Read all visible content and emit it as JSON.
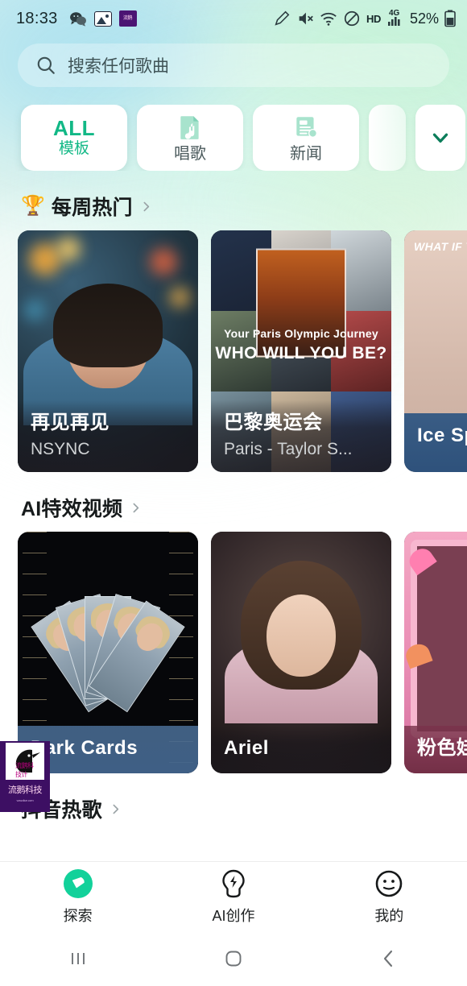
{
  "statusbar": {
    "time": "18:33",
    "icons_left": [
      "wechat-icon",
      "gallery-icon",
      "purple-app-icon"
    ],
    "pen_icon": "pen-icon",
    "mute_icon": "mute-icon",
    "wifi_icon": "wifi-icon",
    "dnd_icon": "do-not-disturb-icon",
    "hd_label": "HD",
    "network_label": "4G",
    "signal_icon": "signal-bars-icon",
    "battery_text": "52%",
    "battery_icon": "battery-icon"
  },
  "search": {
    "placeholder": "搜索任何歌曲",
    "icon": "search-icon"
  },
  "tabs": [
    {
      "id": "all",
      "main": "ALL",
      "sub": "模板",
      "icon": null,
      "selected": true
    },
    {
      "id": "sing",
      "main": "",
      "sub": "唱歌",
      "icon": "music-note-icon",
      "selected": false
    },
    {
      "id": "news",
      "main": "",
      "sub": "新闻",
      "icon": "document-icon",
      "selected": false
    },
    {
      "id": "partial",
      "main": "",
      "sub": "",
      "icon": null,
      "selected": false
    }
  ],
  "expand_button": {
    "icon": "chevron-down-icon",
    "accent": "#0b7d5a"
  },
  "sections": [
    {
      "id": "weekly-hot",
      "emoji": "🏆",
      "title": "每周热门",
      "chevron": "chevron-right-icon",
      "cards": [
        {
          "title": "再见再见",
          "subtitle": "NSYNC",
          "art": "boy-portrait"
        },
        {
          "title": "巴黎奥运会",
          "subtitle": "Paris - Taylor S...",
          "art": "olympic-collage",
          "overlay_line1": "Your Paris Olympic Journey",
          "overlay_line2": "WHO WILL YOU BE?"
        },
        {
          "title": "Ice Spi",
          "subtitle": "",
          "art": "beige-portrait",
          "overlay_line1": "WHAT IF YOU",
          "cut": true
        }
      ]
    },
    {
      "id": "ai-effects",
      "emoji": "",
      "title": "AI特效视频",
      "chevron": "chevron-right-icon",
      "cards": [
        {
          "title": "Dark Cards",
          "subtitle": "",
          "art": "dark-cards"
        },
        {
          "title": "Ariel",
          "subtitle": "",
          "art": "girl-portrait"
        },
        {
          "title": "粉色娃娃",
          "subtitle": "",
          "art": "pink-doll",
          "cut": true
        }
      ]
    },
    {
      "id": "douyin-hot",
      "emoji": "",
      "title": "抖音热歌",
      "chevron": "chevron-right-icon",
      "cards": []
    }
  ],
  "watermark": {
    "line1": "流鹅科技计",
    "line2": "流鹅科技",
    "line3": "www.liue.com",
    "icon": "crow-logo-icon",
    "bg": "#3d0f63"
  },
  "bottom_nav": [
    {
      "id": "explore",
      "label": "探索",
      "icon": "compass-icon",
      "active": true
    },
    {
      "id": "ai-create",
      "label": "AI创作",
      "icon": "lightbulb-bolt-icon",
      "active": false
    },
    {
      "id": "mine",
      "label": "我的",
      "icon": "smiley-face-icon",
      "active": false
    }
  ],
  "android_nav": [
    {
      "id": "recents",
      "icon": "recents-icon"
    },
    {
      "id": "home",
      "icon": "home-icon"
    },
    {
      "id": "back",
      "icon": "back-icon"
    }
  ],
  "colors": {
    "accent_green": "#12b886",
    "nav_active_green": "#12d19a",
    "bg_top": "#cfeef0",
    "bg_mid": "#ddf3ee",
    "bg_bottom": "#ffffff"
  }
}
